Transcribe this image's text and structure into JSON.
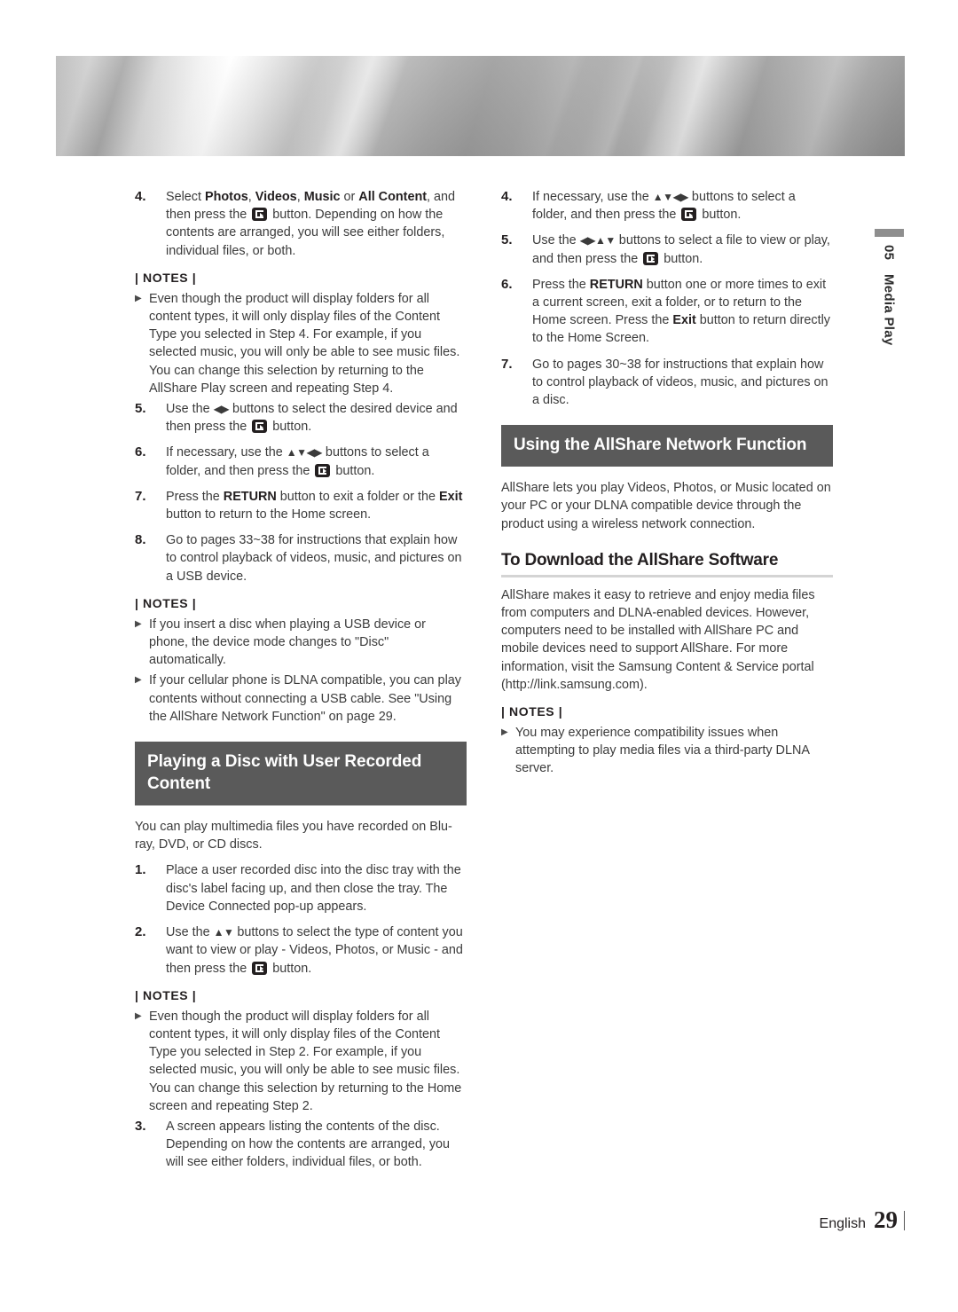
{
  "page": {
    "language": "English",
    "number": "29",
    "chapter_number": "05",
    "chapter_label": "Media Play"
  },
  "left_column": {
    "blocks": [
      {
        "kind": "step",
        "num": "4.",
        "lines": [
          "Select ",
          "Photos",
          ", ",
          "Videos",
          ", ",
          "Music",
          " or ",
          "All Content",
          ", and then press the ",
          "[ENTER]",
          " button. Depending on how the contents are arranged, you will see either folders, individual files, or both."
        ]
      }
    ],
    "step4_text_a": "Select ",
    "step4_bold_photos": "Photos",
    "step4_sep1": ", ",
    "step4_bold_videos": "Videos",
    "step4_sep2": ", ",
    "step4_bold_music": "Music",
    "step4_sep3": " or ",
    "step4_bold_all": "All Content",
    "step4_text_b": ", and then press the ",
    "step4_text_c": " button.",
    "step4_text_d": "Depending on how the contents are arranged, you will see either folders, individual files, or both.",
    "notes_label_1": "| NOTES |",
    "note_1": "Even though the product will display folders for all content types, it will only display files of the Content Type you selected in Step 4. For example, if you selected music, you will only be able to see music files. You can change this selection by returning to the AllShare Play screen and repeating Step 4.",
    "step5_num": "5.",
    "step5_a": "Use the ",
    "step5_arrows": "◀▶",
    "step5_b": " buttons to select the desired device and then press the ",
    "step5_c": " button.",
    "step6_num": "6.",
    "step6_a": "If necessary, use the ",
    "step6_arrows": "▲▼◀▶",
    "step6_b": " buttons to select a folder, and then press the ",
    "step6_c": " button.",
    "step7_num": "7.",
    "step7_a": "Press the ",
    "step7_bold_return": "RETURN",
    "step7_b": " button to exit a folder or the ",
    "step7_bold_exit": "Exit",
    "step7_c": " button to return to the Home screen.",
    "step8_num": "8.",
    "step8_text": "Go to pages 33~38 for instructions that explain how to control playback of videos, music, and pictures on a USB device.",
    "notes_label_2": "| NOTES |",
    "note_2a": "If you insert a disc when playing a USB device or phone, the device mode changes to \"Disc\" automatically.",
    "note_2b": "If your cellular phone is DLNA compatible, you can play contents without connecting a USB cable. See \"Using the AllShare Network Function\" on page 29.",
    "heading_disc": "Playing a Disc with User Recorded Content",
    "disc_intro": "You can play multimedia files you have recorded on Blu-ray, DVD, or CD discs.",
    "disc_step1_num": "1.",
    "disc_step1_text": "Place a user recorded disc into the disc tray with the disc's label facing up, and then close the tray. The Device Connected pop-up appears.",
    "disc_step2_num": "2.",
    "disc_step2_a": "Use the ",
    "disc_step2_arrows": "▲▼",
    "disc_step2_b": " buttons to select the type of content you want to view or play - Videos, Photos, or Music - and then press the ",
    "disc_step2_c": " button.",
    "notes_label_3": "| NOTES |",
    "note_3": "Even though the product will display folders for all content types, it will only display files of the Content Type you selected in Step 2. For example, if you selected music, you will only be able to see music files. You can change this selection by returning to the Home screen and repeating Step 2.",
    "disc_step3_num": "3.",
    "disc_step3_text": "A screen appears listing the contents of the disc. Depending on how the contents are arranged, you will see either folders, individual files, or both."
  },
  "right_column": {
    "step4_num": "4.",
    "step4_a": "If necessary, use the ",
    "step4_arrows": "▲▼◀▶",
    "step4_b": " buttons to select a folder, and then press the ",
    "step4_c": " button.",
    "step5_num": "5.",
    "step5_a": "Use the ",
    "step5_arrows": "◀▶▲▼",
    "step5_b": " buttons to select a file to view or play, and then press the ",
    "step5_c": " button.",
    "step6_num": "6.",
    "step6_a": "Press the ",
    "step6_bold_return": "RETURN",
    "step6_b": " button one or more times to exit a current screen, exit a folder, or to return to the Home screen.",
    "step6_c": "Press the ",
    "step6_bold_exit": "Exit",
    "step6_d": " button to return directly to the Home Screen.",
    "step7_num": "7.",
    "step7_text": "Go to pages 30~38 for instructions that explain how to control playback of videos, music, and pictures on a disc.",
    "heading_allshare": "Using the AllShare Network Function",
    "allshare_intro": "AllShare lets you play Videos, Photos, or Music located on your PC or your DLNA compatible device through the product using a wireless network connection.",
    "subheading_download": "To Download the AllShare Software",
    "download_body": "AllShare makes it easy to retrieve and enjoy media files from computers and DLNA-enabled devices. However, computers need to be installed with AllShare PC and mobile devices need to support AllShare. For more information, visit the Samsung Content & Service portal (http://link.samsung.com).",
    "notes_label": "| NOTES |",
    "note_1": "You may experience compatibility issues when attempting to play media files via a third-party DLNA server."
  },
  "colors": {
    "heading_bar_bg": "#5a5a5a",
    "body_text": "#3b3b3b",
    "strong_text": "#231f20",
    "rule": "#d4d4d4",
    "side_tab_bar": "#8e8e8e"
  },
  "icons": {
    "enter_button": "enter-key-icon",
    "note_bullet": "▶"
  }
}
